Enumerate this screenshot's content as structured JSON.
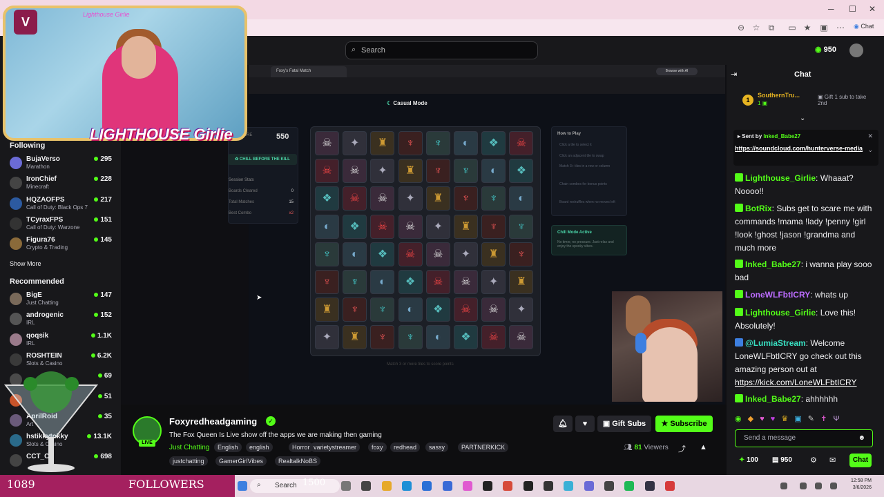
{
  "browser": {
    "right_label": "Chat"
  },
  "topnav": {
    "search_placeholder": "Search",
    "points": "950"
  },
  "sidebar": {
    "following_label": "Following",
    "following": [
      {
        "name": "BujaVerso",
        "category": "Marathon",
        "viewers": "295",
        "color": "#6b6bd6"
      },
      {
        "name": "IronChief",
        "category": "Minecraft",
        "viewers": "228",
        "color": "#444"
      },
      {
        "name": "HQZAOFPS",
        "category": "Call of Duty: Black Ops 7",
        "viewers": "217",
        "color": "#2c5aa0"
      },
      {
        "name": "TCyraxFPS",
        "category": "Call of Duty: Warzone",
        "viewers": "151",
        "color": "#333"
      },
      {
        "name": "Figura76",
        "category": "Crypto & Trading",
        "viewers": "145",
        "color": "#8a6a3a"
      }
    ],
    "show_more": "Show More",
    "recommended_label": "Recommended",
    "recommended": [
      {
        "name": "BigE",
        "category": "Just Chatting",
        "viewers": "147",
        "color": "#7a6a5a"
      },
      {
        "name": "androgenic",
        "category": "IRL",
        "viewers": "152",
        "color": "#555"
      },
      {
        "name": "qoqsik",
        "category": "IRL",
        "viewers": "1.1K",
        "color": "#9a7a8a"
      },
      {
        "name": "ROSHTEIN",
        "category": "Slots & Casino",
        "viewers": "6.2K",
        "color": "#3a3a3a"
      },
      {
        "name": "",
        "category": "",
        "viewers": "69",
        "color": "#4a4a4a"
      },
      {
        "name": "",
        "category": "",
        "viewers": "51",
        "color": "#c8542a"
      },
      {
        "name": "AprilRoid",
        "category": "Art",
        "viewers": "35",
        "color": "#6a5a7a"
      },
      {
        "name": "hstikkytokky",
        "category": "Slots & Casino",
        "viewers": "13.1K",
        "color": "#2a6a8a"
      },
      {
        "name": "CCT_CS",
        "category": "",
        "viewers": "698",
        "color": "#444"
      }
    ]
  },
  "overlay": {
    "cam_watermark": "Lighthouse Girlie",
    "logo_text": "LIGHTHOUSE Girlie",
    "followers_count": "1089",
    "followers_label": "FOLLOWERS",
    "taskbar_number": "1500"
  },
  "game": {
    "tab_title": "Foxy's Fatal Match",
    "browse_ai": "Browse with AI",
    "mode": "Casual Mode",
    "score_label": "SCORE",
    "score": "550",
    "chill_button": "CHILL BEFORE THE KILL",
    "session_title": "Session Stats",
    "stats": [
      {
        "label": "Boards Cleared",
        "value": "0"
      },
      {
        "label": "Total Matches",
        "value": "15"
      },
      {
        "label": "Best Combo",
        "value": "x2"
      }
    ],
    "howto_title": "How to Play",
    "howto": [
      "Click a tile to select it",
      "Click an adjacent tile to swap",
      "Match 3+ tiles in a row or column",
      "Chain combos for bonus points",
      "Board reshuffles when no moves left"
    ],
    "chill_title": "Chill Mode Active",
    "chill_desc": "No timer, no pressure. Just relax and enjoy the spooky vibes.",
    "hint": "Match 3 or more tiles to score points"
  },
  "stream": {
    "channel": "Foxyredheadgaming",
    "live": "LIVE",
    "title": "The Fox Queen Is Live show off the apps we are making then gaming",
    "category": "Just Chatting",
    "tags": [
      "English",
      "english",
      "Horror",
      "varietystreamer",
      "foxy",
      "redhead",
      "sassy",
      "PARTNERKICK",
      "justchatting",
      "GamerGirlVibes",
      "RealtalkNoBS"
    ],
    "gift_subs": "Gift Subs",
    "subscribe": "Subscribe",
    "viewers_count": "81",
    "viewers_label": "Viewers"
  },
  "chat": {
    "title": "Chat",
    "top_gifter": {
      "rank": "1",
      "name": "SouthernTru...",
      "count": "1",
      "gift_text": "Gift 1 sub to take 2nd"
    },
    "pinned": {
      "sent_by": "Sent by",
      "user": "Inked_Babe27",
      "link": "https://soundcloud.com/hunterverse-media"
    },
    "messages": [
      {
        "user": "Lighthouse_Girlie",
        "color": "green",
        "text": "Whaaat? Noooo!!"
      },
      {
        "user": "BotRix",
        "color": "green",
        "text": "Subs get to scare me with commands !mama !lady !penny !girl !look !ghost !jason !grandma and much more"
      },
      {
        "user": "Inked_Babe27",
        "color": "green",
        "text": "i wanna play sooo bad"
      },
      {
        "user": "LoneWLFbtICRY",
        "color": "purple",
        "text": "whats up"
      },
      {
        "user": "Lighthouse_Girlie",
        "color": "green",
        "text": "Love this! Absolutely!"
      },
      {
        "user": "@LumiaStream",
        "color": "cyan",
        "text": "Welcome LoneWLFbtICRY go check out this amazing person out at",
        "link": "https://kick.com/LoneWLFbtICRY"
      },
      {
        "user": "Inked_Babe27",
        "color": "green",
        "text": "ahhhhhh"
      }
    ],
    "input_placeholder": "Send a message",
    "points": "100",
    "channel_points": "950",
    "send": "Chat"
  },
  "taskbar": {
    "search": "Search",
    "time": "12:58 PM",
    "date": "3/6/2026"
  }
}
